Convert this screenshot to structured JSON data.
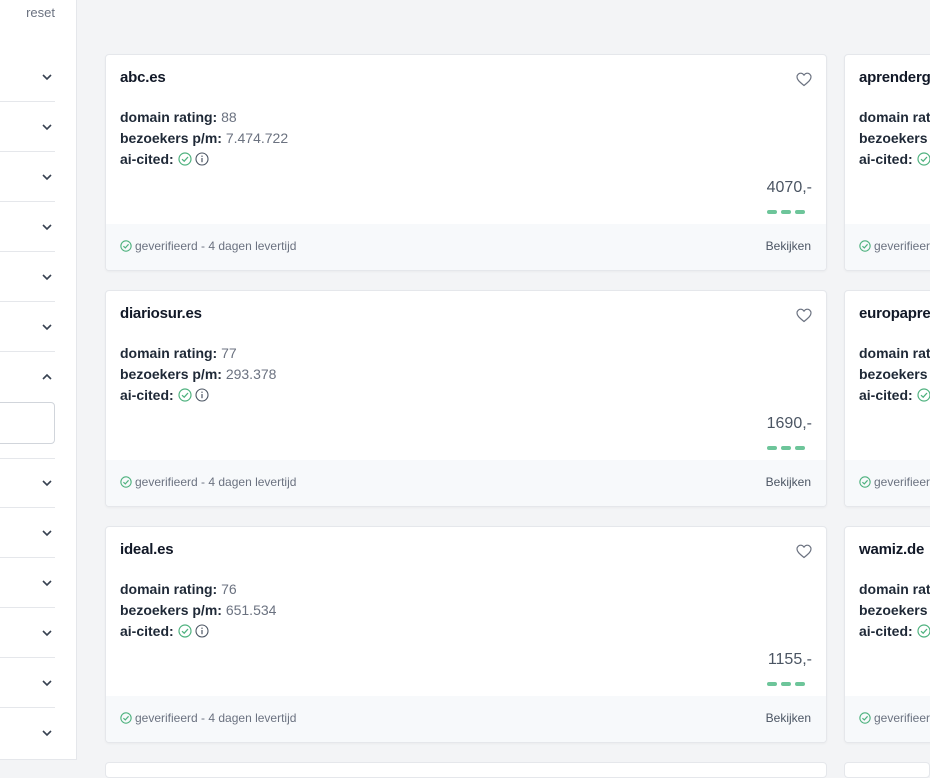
{
  "sidebar": {
    "reset_label": "reset"
  },
  "cards_main": [
    {
      "domain": "abc.es",
      "domain_rating_label": "domain rating:",
      "domain_rating": "88",
      "visitors_label": "bezoekers p/m:",
      "visitors": "7.474.722",
      "ai_cited_label": "ai-cited:",
      "price": "4070,-",
      "verified": "geverifieerd - 4 dagen levertijd",
      "view_label": "Bekijken"
    },
    {
      "domain": "diariosur.es",
      "domain_rating_label": "domain rating:",
      "domain_rating": "77",
      "visitors_label": "bezoekers p/m:",
      "visitors": "293.378",
      "ai_cited_label": "ai-cited:",
      "price": "1690,-",
      "verified": "geverifieerd - 4 dagen levertijd",
      "view_label": "Bekijken"
    },
    {
      "domain": "ideal.es",
      "domain_rating_label": "domain rating:",
      "domain_rating": "76",
      "visitors_label": "bezoekers p/m:",
      "visitors": "651.534",
      "ai_cited_label": "ai-cited:",
      "price": "1155,-",
      "verified": "geverifieerd - 4 dagen levertijd",
      "view_label": "Bekijken"
    }
  ],
  "cards_side": [
    {
      "domain": "aprenderg",
      "domain_rating_label": "domain rati",
      "visitors_label": "bezoekers p",
      "ai_cited_label": "ai-cited:",
      "verified": "geverifieer"
    },
    {
      "domain": "europapre",
      "domain_rating_label": "domain rati",
      "visitors_label": "bezoekers p",
      "ai_cited_label": "ai-cited:",
      "verified": "geverifieer"
    },
    {
      "domain": "wamiz.de",
      "domain_rating_label": "domain rati",
      "visitors_label": "bezoekers p",
      "ai_cited_label": "ai-cited:",
      "verified": "geverifieer"
    }
  ],
  "colors": {
    "accent_green": "#6dc59a",
    "check_green": "#4fb27f"
  },
  "icons": {
    "heart": "heart-icon",
    "check": "check-circle-icon",
    "info": "info-icon",
    "chevron": "chevron-down-icon"
  }
}
